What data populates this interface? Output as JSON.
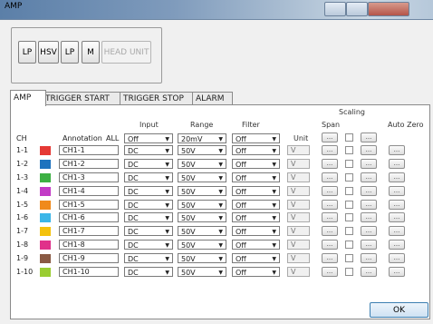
{
  "window": {
    "title": "AMP"
  },
  "modules": [
    {
      "label": "LP",
      "enabled": true
    },
    {
      "label": "HSV",
      "enabled": true
    },
    {
      "label": "LP",
      "enabled": true
    },
    {
      "label": "M",
      "enabled": true
    },
    {
      "label": "HEAD UNIT",
      "enabled": false
    }
  ],
  "tabs": [
    {
      "label": "AMP",
      "active": true
    },
    {
      "label": "TRIGGER START",
      "active": false
    },
    {
      "label": "TRIGGER STOP",
      "active": false
    },
    {
      "label": "ALARM",
      "active": false
    }
  ],
  "headers": {
    "ch": "CH",
    "annotation": "Annotation",
    "all": "ALL",
    "input": "Input",
    "range": "Range",
    "filter": "Filter",
    "unit": "Unit",
    "span": "Span",
    "scaling": "Scaling",
    "auto_zero": "Auto Zero"
  },
  "all_row": {
    "input": "Off",
    "range": "20mV",
    "filter": "Off",
    "ellipsis": "..."
  },
  "channels": [
    {
      "ch": "1-1",
      "color": "#e53935",
      "annotation": "CH1-1",
      "input": "DC",
      "range": "50V",
      "filter": "Off",
      "unit": "V"
    },
    {
      "ch": "1-2",
      "color": "#1e73be",
      "annotation": "CH1-2",
      "input": "DC",
      "range": "50V",
      "filter": "Off",
      "unit": "V"
    },
    {
      "ch": "1-3",
      "color": "#3cb043",
      "annotation": "CH1-3",
      "input": "DC",
      "range": "50V",
      "filter": "Off",
      "unit": "V"
    },
    {
      "ch": "1-4",
      "color": "#c23bc6",
      "annotation": "CH1-4",
      "input": "DC",
      "range": "50V",
      "filter": "Off",
      "unit": "V"
    },
    {
      "ch": "1-5",
      "color": "#f08a1c",
      "annotation": "CH1-5",
      "input": "DC",
      "range": "50V",
      "filter": "Off",
      "unit": "V"
    },
    {
      "ch": "1-6",
      "color": "#3bb6e8",
      "annotation": "CH1-6",
      "input": "DC",
      "range": "50V",
      "filter": "Off",
      "unit": "V"
    },
    {
      "ch": "1-7",
      "color": "#f4c20d",
      "annotation": "CH1-7",
      "input": "DC",
      "range": "50V",
      "filter": "Off",
      "unit": "V"
    },
    {
      "ch": "1-8",
      "color": "#e0318a",
      "annotation": "CH1-8",
      "input": "DC",
      "range": "50V",
      "filter": "Off",
      "unit": "V"
    },
    {
      "ch": "1-9",
      "color": "#8a5a44",
      "annotation": "CH1-9",
      "input": "DC",
      "range": "50V",
      "filter": "Off",
      "unit": "V"
    },
    {
      "ch": "1-10",
      "color": "#9acd32",
      "annotation": "CH1-10",
      "input": "DC",
      "range": "50V",
      "filter": "Off",
      "unit": "V"
    }
  ],
  "ellipsis": "...",
  "ok_label": "OK"
}
